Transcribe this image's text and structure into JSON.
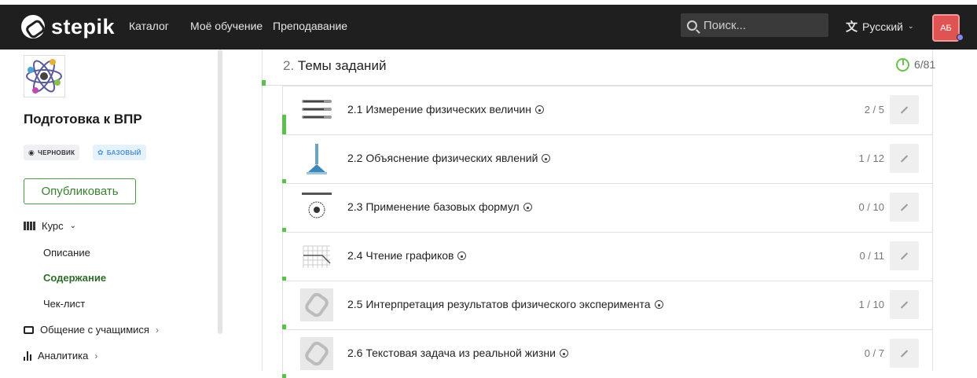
{
  "topbar": {
    "logo_text": "stepik",
    "nav": [
      "Каталог",
      "Моё обучение",
      "Преподавание"
    ],
    "search_placeholder": "Поиск...",
    "language": "Русский",
    "language_icon": "translate-icon",
    "avatar_initials": "АБ",
    "colors": {
      "bar": "#1f1f1f",
      "avatar": "#e05353"
    }
  },
  "sidebar": {
    "course_title": "Подготовка к ВПР",
    "badges": {
      "draft": "ЧЕРНОВИК",
      "basic": "БАЗОВЫЙ"
    },
    "publish_label": "Опубликовать",
    "course_menu": "Курс",
    "sub_items": [
      "Описание",
      "Содержание",
      "Чек-лист"
    ],
    "active_sub": "Содержание",
    "communication": "Общение с учащимися",
    "analytics": "Аналитика",
    "accent": "#3b7f31"
  },
  "section": {
    "number": "2.",
    "title": "Темы заданий",
    "progress": "6/81",
    "progress_fraction": 0.074
  },
  "lessons": [
    {
      "title": "2.1 Измерение физических величин",
      "count": "2 / 5",
      "done_fraction": 0.4,
      "thumb": "thermometers"
    },
    {
      "title": "2.2 Объяснение физических явлений",
      "count": "1 / 12",
      "done_fraction": 0.083,
      "thumb": "rocket"
    },
    {
      "title": "2.3 Применение базовых формул",
      "count": "0 / 10",
      "done_fraction": 0.0,
      "thumb": "diagram"
    },
    {
      "title": "2.4 Чтение графиков",
      "count": "0 / 11",
      "done_fraction": 0.0,
      "thumb": "graph"
    },
    {
      "title": "2.5 Интерпретация результатов физического эксперимента",
      "count": "1 / 10",
      "done_fraction": 0.1,
      "thumb": "placeholder"
    },
    {
      "title": "2.6 Текстовая задача из реальной жизни",
      "count": "0 / 7",
      "done_fraction": 0.0,
      "thumb": "placeholder"
    }
  ]
}
